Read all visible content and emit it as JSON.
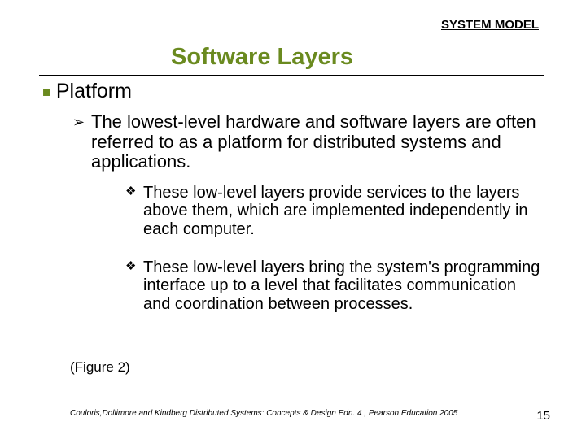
{
  "header": {
    "label": "SYSTEM MODEL"
  },
  "title": "Software Layers",
  "section": {
    "heading": "Platform",
    "sub1": "The lowest-level hardware and software layers are often referred to as a platform for distributed systems and applications.",
    "sub2a": "These low-level layers provide services to the layers above them, which are implemented independently in each computer.",
    "sub2b": "These low-level layers bring the system's programming interface up to a level that facilitates communication and coordination between processes."
  },
  "figure_ref": "(Figure 2)",
  "citation": "Couloris,Dollimore and Kindberg  Distributed Systems: Concepts & Design  Edn. 4 , Pearson Education 2005",
  "page": "15"
}
